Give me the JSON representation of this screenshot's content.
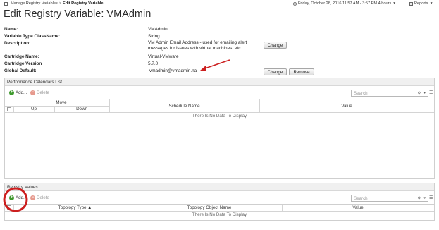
{
  "breadcrumb": {
    "parent": "Manage Registry Variables",
    "separator": ">",
    "current": "Edit Registry Variable"
  },
  "header": {
    "datetime": "Friday, October 28, 2016 11:57 AM - 3:57 PM 4 hours",
    "reports": "Reports"
  },
  "page_title": "Edit Registry Variable: VMAdmin",
  "properties": {
    "name_label": "Name:",
    "name_value": "VMAdmin",
    "type_label": "Variable Type ClassName:",
    "type_value": "String",
    "description_label": "Description:",
    "description_value": "VM Admin Email Address - used for emailing alert messages for issues with virtual machines, etc.",
    "cartridge_name_label": "Cartridge Name:",
    "cartridge_name_value": "Virtual-VMware",
    "cartridge_version_label": "Cartridge Version",
    "cartridge_version_value": "5.7.0",
    "global_default_label": "Global Default:",
    "global_default_value": "vmadmin@vmadmin.na"
  },
  "buttons": {
    "change_description": "Change",
    "change_default": "Change",
    "remove_default": "Remove"
  },
  "calendars_panel": {
    "title": "Performance Calendars List",
    "add": "Add...",
    "delete": "Delete",
    "search_placeholder": "Search",
    "columns": {
      "move": "Move",
      "up": "Up",
      "down": "Down",
      "schedule_name": "Schedule Name",
      "value": "Value"
    },
    "empty": "There Is No Data To Display"
  },
  "registry_panel": {
    "title": "Registry Values",
    "add": "Add...",
    "delete": "Delete",
    "search_placeholder": "Search",
    "columns": {
      "topology_type": "Topology Type ▲",
      "topology_object_name": "Topology Object Name",
      "value": "Value"
    },
    "empty": "There Is No Data To Display"
  },
  "colors": {
    "add_icon": "#3f9a2e",
    "delete_icon": "#e69a8e",
    "annotation": "#cc1f1f"
  }
}
